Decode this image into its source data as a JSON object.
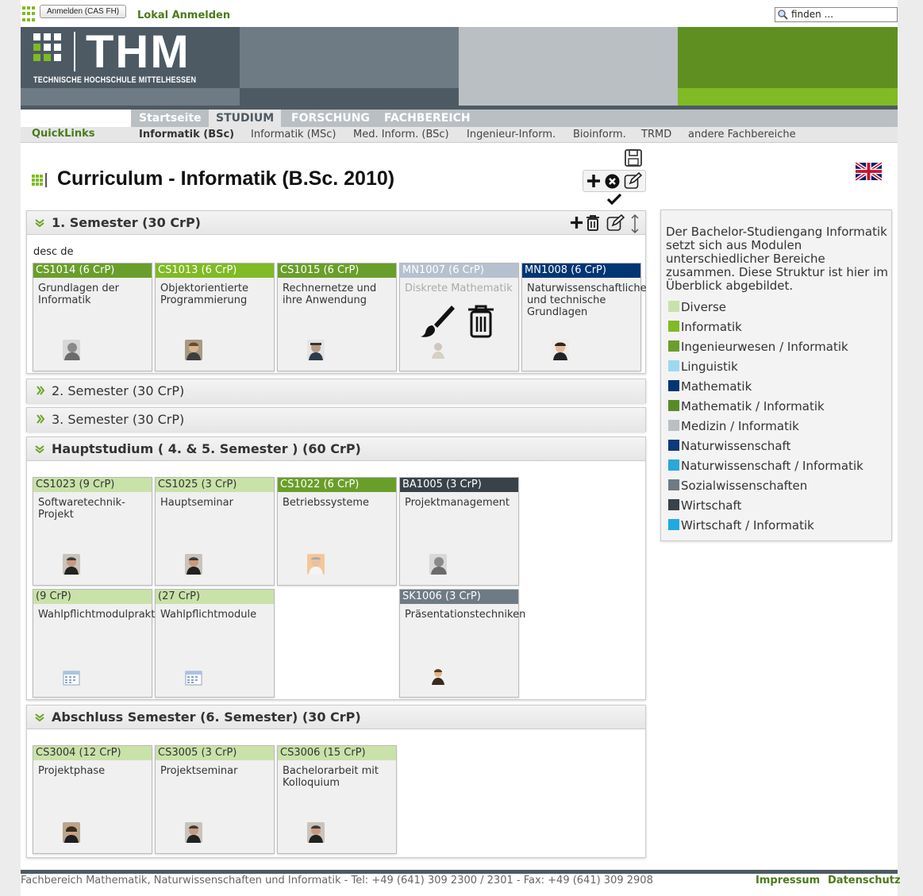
{
  "topbar": {
    "cas_button": "Anmelden (CAS FH)",
    "local_login": "Lokal Anmelden",
    "search_placeholder": "finden ..."
  },
  "header": {
    "logo_text": "THM",
    "logo_subtitle": "TECHNISCHE HOCHSCHULE MITTELHESSEN"
  },
  "nav": {
    "items": [
      "Startseite",
      "STUDIUM",
      "FORSCHUNG",
      "FACHBEREICH"
    ],
    "active": "STUDIUM"
  },
  "subnav": {
    "quicklinks": "QuickLinks",
    "items": [
      "Informatik (BSc)",
      "Informatik (MSc)",
      "Med. Inform. (BSc)",
      "Ingenieur-Inform.",
      "Bioinform.",
      "TRMD",
      "andere Fachbereiche"
    ],
    "active": "Informatik (BSc)"
  },
  "page": {
    "title": "Curriculum - Informatik (B.Sc. 2010)"
  },
  "semesters": [
    {
      "title": "1. Semester (30 CrP)",
      "expanded": true,
      "desc": "desc de",
      "modules": [
        {
          "code": "CS1014 (6 CrP)",
          "name": "Grundlagen der Informatik",
          "color": "ing",
          "avatar": "person-photo"
        },
        {
          "code": "CS1013 (6 CrP)",
          "name": "Objektorientierte Programmierung",
          "color": "info",
          "avatar": "person-photo"
        },
        {
          "code": "CS1015 (6 CrP)",
          "name": "Rechnernetze und ihre Anwendung",
          "color": "ing",
          "avatar": "person-photo"
        },
        {
          "code": "MN1007 (6 CrP)",
          "name": "Diskrete Mathematik",
          "color": "dis",
          "avatar": "person-placeholder"
        },
        {
          "code": "MN1008 (6 CrP)",
          "name": "Naturwissenschaftliche und technische Grundlagen",
          "color": "math",
          "avatar": "person-photo"
        }
      ]
    },
    {
      "title": "2. Semester (30 CrP)",
      "expanded": false
    },
    {
      "title": "3. Semester (30 CrP)",
      "expanded": false
    },
    {
      "title": "Hauptstudium ( 4. & 5. Semester ) (60 CrP)",
      "expanded": true,
      "modules": [
        {
          "code": "CS1023 (9 CrP)",
          "name": "Softwaretechnik-Projekt",
          "color": "div"
        },
        {
          "code": "CS1025 (3 CrP)",
          "name": "Hauptseminar",
          "color": "div"
        },
        {
          "code": "CS1022 (6 CrP)",
          "name": "Betriebssysteme",
          "color": "ing"
        },
        {
          "code": "BA1005 (3 CrP)",
          "name": "Projektmanagement",
          "color": "wirt"
        },
        {
          "code": "(9 CrP)",
          "name": "Wahlpflichtmodulpraktika",
          "color": "div"
        },
        {
          "code": "(27 CrP)",
          "name": "Wahlpflichtmodule",
          "color": "div"
        },
        {
          "code": "SK1006 (3 CrP)",
          "name": "Präsentationstechniken",
          "color": "soz"
        }
      ]
    },
    {
      "title": "Abschluss Semester (6. Semester) (30 CrP)",
      "expanded": true,
      "modules": [
        {
          "code": "CS3004 (12 CrP)",
          "name": "Projektphase",
          "color": "div"
        },
        {
          "code": "CS3005 (3 CrP)",
          "name": "Projektseminar",
          "color": "div"
        },
        {
          "code": "CS3006 (15 CrP)",
          "name": "Bachelorarbeit mit Kolloquium",
          "color": "div"
        }
      ]
    }
  ],
  "sidebar": {
    "intro": "Der Bachelor-Studiengang Informatik setzt sich aus Modulen unterschiedlicher Bereiche zusammen. Diese Struktur ist hier im Überblick abgebildet.",
    "legend": [
      {
        "label": "Diverse",
        "color": "#c9e2a9"
      },
      {
        "label": "Informatik",
        "color": "#80ba24"
      },
      {
        "label": "Ingenieurwesen / Informatik",
        "color": "#6a9e2a"
      },
      {
        "label": "Linguistik",
        "color": "#9ed8ee"
      },
      {
        "label": "Mathematik",
        "color": "#003674"
      },
      {
        "label": "Mathematik / Informatik",
        "color": "#5a8a28"
      },
      {
        "label": "Medizin / Informatik",
        "color": "#b9bfc3"
      },
      {
        "label": "Naturwissenschaft",
        "color": "#0e3a78"
      },
      {
        "label": "Naturwissenschaft / Informatik",
        "color": "#2aa7d8"
      },
      {
        "label": "Sozialwissenschaften",
        "color": "#6e7b84"
      },
      {
        "label": "Wirtschaft",
        "color": "#394249"
      },
      {
        "label": "Wirtschaft / Informatik",
        "color": "#1faadf"
      }
    ]
  },
  "footer": {
    "text": "Fachbereich Mathematik, Naturwissenschaften und Informatik - Tel: +49 (641) 309 2300 / 2301 - Fax: +49 (641) 309 2908",
    "impressum": "Impressum",
    "datenschutz": "Datenschutz"
  }
}
